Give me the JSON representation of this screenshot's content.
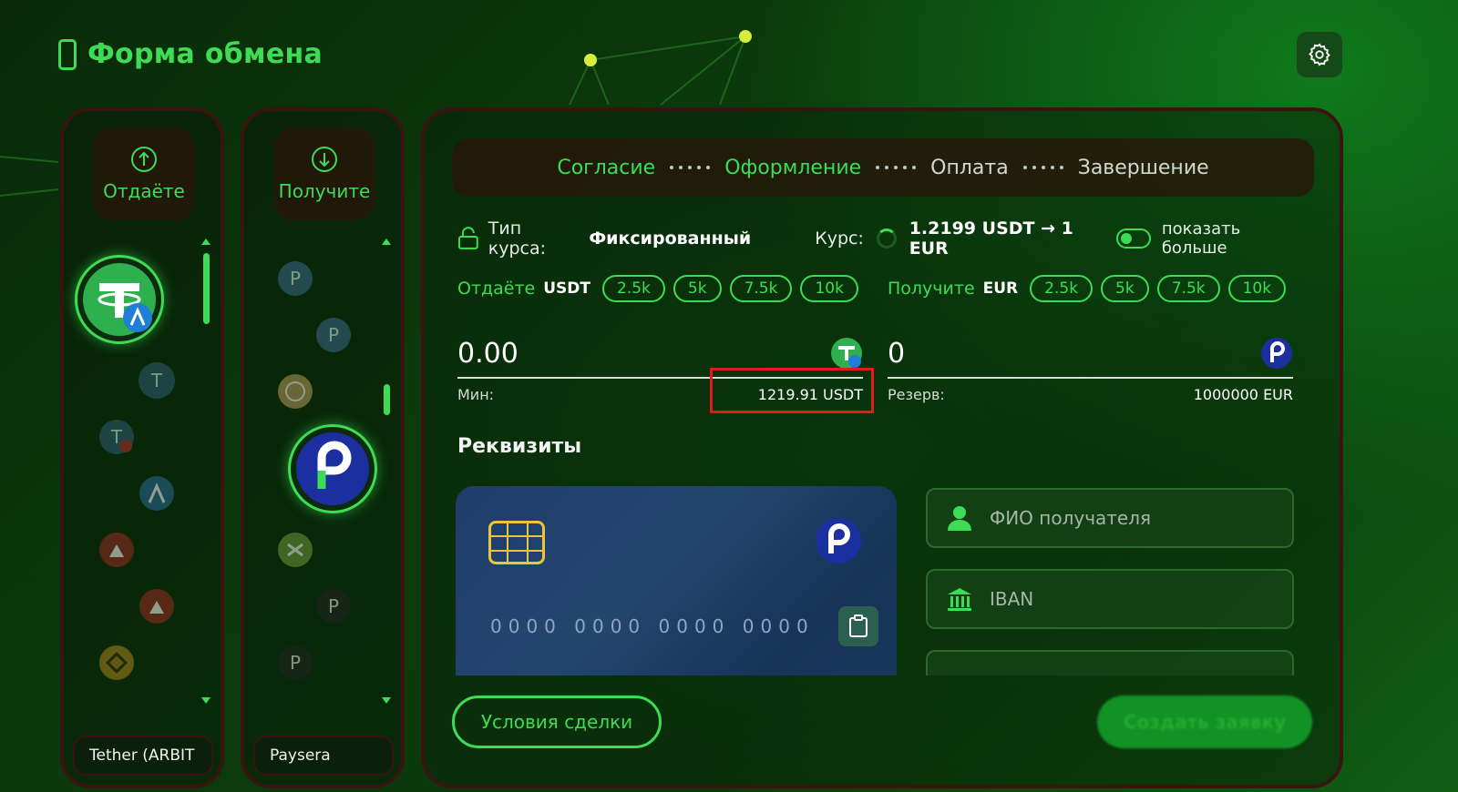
{
  "header": {
    "title": "Форма обмена"
  },
  "give_column": {
    "label": "Отдаёте",
    "selected_label": "Tether (ARBIT",
    "selected_icon": "tether-arbitrum-icon"
  },
  "get_column": {
    "label": "Получите",
    "selected_label": "Paysera",
    "selected_icon": "paysera-icon"
  },
  "steps": [
    {
      "label": "Согласие",
      "state": "done"
    },
    {
      "label": "Оформление",
      "state": "active"
    },
    {
      "label": "Оплата",
      "state": "pending"
    },
    {
      "label": "Завершение",
      "state": "pending"
    }
  ],
  "rate": {
    "type_label": "Тип курса:",
    "type_value": "Фиксированный",
    "rate_label": "Курс:",
    "rate_value": "1.2199 USDT → 1 EUR",
    "more_label": "показать больше"
  },
  "give_amount": {
    "label": "Отдаёте",
    "currency": "USDT",
    "chips": [
      "2.5k",
      "5k",
      "7.5k",
      "10k"
    ],
    "value": "0.00",
    "meta_label": "Мин:",
    "meta_value": "1219.91 USDT"
  },
  "get_amount": {
    "label": "Получите",
    "currency": "EUR",
    "chips": [
      "2.5k",
      "5k",
      "7.5k",
      "10k"
    ],
    "value": "0",
    "meta_label": "Резерв:",
    "meta_value": "1000000 EUR"
  },
  "requisites": {
    "title": "Реквизиты",
    "card_number_placeholder": "0000 0000 0000 0000",
    "recipient_placeholder": "ФИО получателя",
    "iban_placeholder": "IBAN"
  },
  "actions": {
    "terms": "Условия сделки",
    "create": "Создать заявку"
  },
  "colors": {
    "accent": "#3ddc54",
    "highlight": "#e21b1b",
    "card": "#1f3d6a"
  }
}
